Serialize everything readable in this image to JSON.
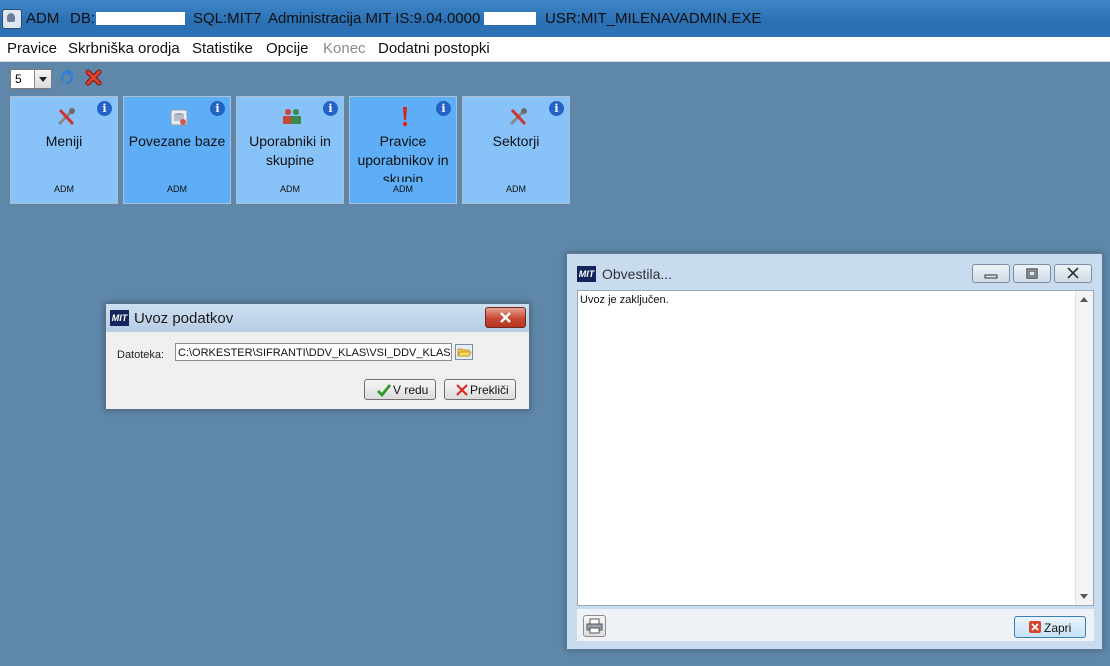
{
  "titlebar": {
    "adm": "ADM",
    "db_label": "DB:",
    "sql": "SQL:MIT7",
    "app": "Administracija MIT IS:9.04.0000",
    "user": "USR:MIT_MILENA",
    "exe": "VADMIN.EXE"
  },
  "menu": {
    "items": [
      "Pravice",
      "Skrbniška orodja",
      "Statistike",
      "Opcije",
      "Konec",
      "Dodatni postopki"
    ]
  },
  "toolbar": {
    "select_value": "5"
  },
  "tiles": [
    {
      "label": "Meniji",
      "sub": "ADM",
      "info": "i"
    },
    {
      "label": "Povezane baze",
      "sub": "ADM",
      "info": "i"
    },
    {
      "label": "Uporabniki in skupine",
      "sub": "ADM",
      "info": "i"
    },
    {
      "label": "Pravice uporabnikov in skupin",
      "sub": "ADM",
      "info": "i"
    },
    {
      "label": "Sektorji",
      "sub": "ADM",
      "info": "i"
    }
  ],
  "import_dialog": {
    "logo": "MIT",
    "title": "Uvoz podatkov",
    "file_label": "Datoteka:",
    "file_value": "C:\\ORKESTER\\SIFRANTI\\DDV_KLAS\\VSI_DDV_KLAS",
    "ok_label": "V redu",
    "cancel_label": "Prekliči"
  },
  "notifications": {
    "logo": "MIT",
    "title": "Obvestila...",
    "message": "Uvoz je zaključen.",
    "close_label": "Zapri"
  },
  "colors": {
    "desktop": "#5f87a9",
    "tile_light": "#87c2f9",
    "tile_dark": "#5daef7",
    "info_blue": "#2462c4"
  }
}
